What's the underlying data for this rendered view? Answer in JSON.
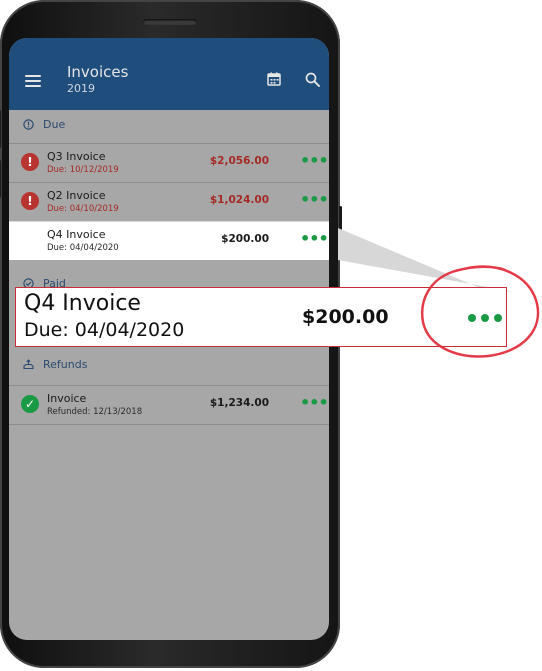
{
  "app": {
    "title": "Invoices",
    "subtitle": "2019",
    "icons": {
      "menu": "hamburger-icon",
      "calendar": "calendar-icon",
      "search": "search-icon"
    }
  },
  "sections": {
    "due": {
      "label": "Due",
      "icon": "info-circle-icon"
    },
    "paid": {
      "label": "Paid",
      "icon": "check-circle-icon"
    },
    "refunds": {
      "label": "Refunds",
      "icon": "refund-icon"
    }
  },
  "due_rows": [
    {
      "title": "Q3 Invoice",
      "due": "Due: 10/12/2019",
      "amount": "$2,056.00",
      "status": "!"
    },
    {
      "title": "Q2 Invoice",
      "due": "Due: 04/10/2019",
      "amount": "$1,024.00",
      "status": "!"
    },
    {
      "title": "Q4 Invoice",
      "due": "Due: 04/04/2020",
      "amount": "$200.00"
    }
  ],
  "refund_rows": [
    {
      "title": "Invoice",
      "due": "Refunded: 12/13/2018",
      "amount": "$1,234.00",
      "status": "✓"
    }
  ],
  "callout": {
    "title": "Q4 Invoice",
    "due": "Due: 04/04/2020",
    "amount": "$200.00"
  },
  "more_glyph": "•••",
  "colors": {
    "appbar": "#1f4e7d",
    "accent_green": "#1a9a44",
    "error_red": "#b83431",
    "highlight_red": "#c62d35"
  }
}
